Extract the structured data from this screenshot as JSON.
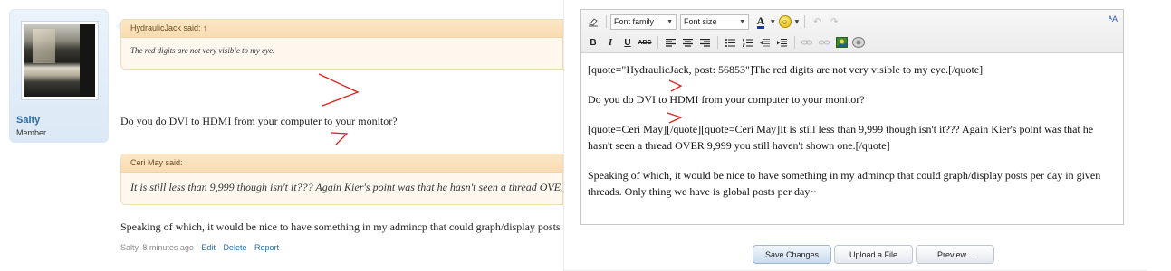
{
  "post": {
    "username": "Salty",
    "user_title": "Member",
    "quote1": {
      "header": "HydraulicJack said: ↑",
      "body": "The red digits are not very visible to my eye."
    },
    "text1": "Do you do DVI to HDMI from your computer to your monitor?",
    "quote2": {
      "header": "Ceri May said:",
      "body": "It is still less than 9,999 though isn't it??? Again Kier's point was that he hasn't seen a thread OVER 9,999 you still haven't shown one."
    },
    "text2": "Speaking of which, it would be nice to have something in my admincp that could graph/display posts per day in given threads. Only thing we have is global posts per day~",
    "meta": {
      "author_time": "Salty, 8 minutes ago",
      "edit": "Edit",
      "delete": "Delete",
      "report": "Report"
    }
  },
  "editor": {
    "toolbar": {
      "font_family": "Font family",
      "font_size": "Font size",
      "font_color": "A",
      "toggle_size": "ᴬA"
    },
    "content": [
      "[quote=\"HydraulicJack, post: 56853\"]The red digits are not very visible to my eye.[/quote]",
      "Do you do DVI to HDMI from your computer to your monitor?",
      "[quote=Ceri May][/quote][quote=Ceri May]It is still less than 9,999 though isn't it??? Again Kier's point was that he hasn't seen a thread OVER 9,999 you still haven't shown one.[/quote]",
      "Speaking of which, it would be nice to have something in my admincp that could graph/display posts per day in given threads. Only thing we have is global posts per day~"
    ],
    "buttons": {
      "save": "Save Changes",
      "upload": "Upload a File",
      "preview": "Preview..."
    }
  },
  "colors": {
    "annotation": "#e0201b",
    "link": "#2a6ca3",
    "quote_header_bg": "#f8dcb3"
  }
}
